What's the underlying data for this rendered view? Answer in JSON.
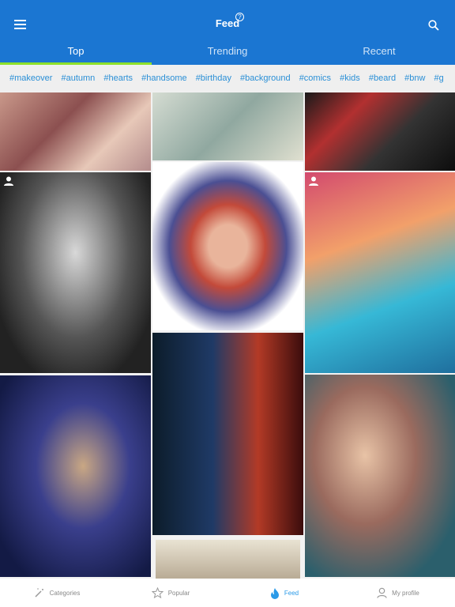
{
  "header": {
    "title": "Feed",
    "help_icon": "?"
  },
  "tabs": [
    {
      "label": "Top",
      "active": true
    },
    {
      "label": "Trending"
    },
    {
      "label": "Recent"
    }
  ],
  "tags": [
    "#makeover",
    "#autumn",
    "#hearts",
    "#handsome",
    "#birthday",
    "#background",
    "#comics",
    "#kids",
    "#beard",
    "#bnw",
    "#g"
  ],
  "colors": {
    "brand": "#1b76d2",
    "tab_indicator": "#8de02a",
    "tag": "#2a8fd6",
    "active_nav": "#2a9ae8"
  },
  "nav": [
    {
      "label": "Categories",
      "icon": "magic-wand-icon"
    },
    {
      "label": "Popular",
      "icon": "star-icon"
    },
    {
      "label": "Feed",
      "icon": "flame-icon",
      "active": true
    },
    {
      "label": "My profile",
      "icon": "person-icon"
    }
  ]
}
